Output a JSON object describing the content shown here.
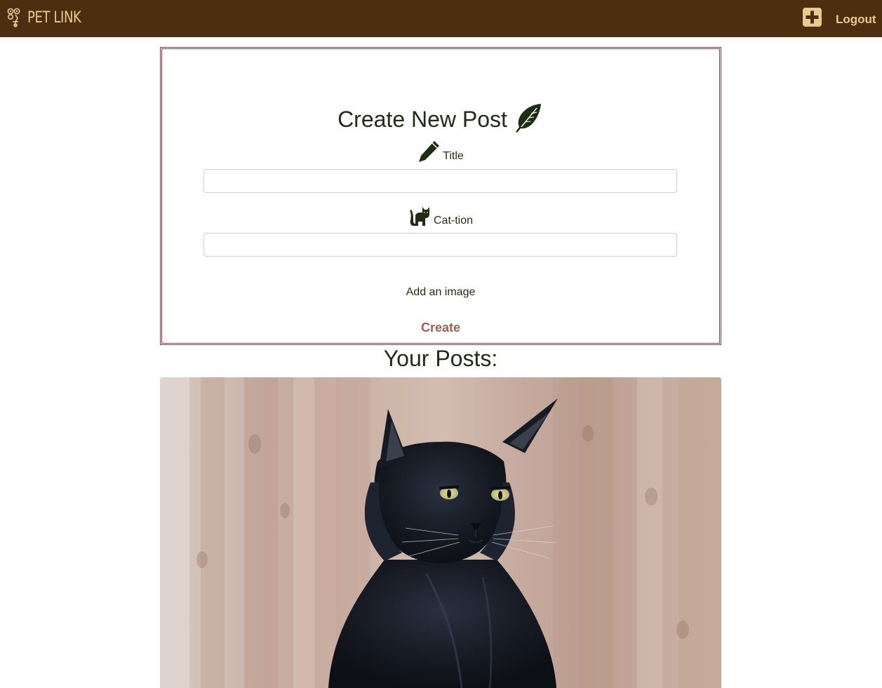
{
  "navbar": {
    "brand_text": "PET LINK",
    "logout_label": "Logout",
    "brand_color": "#e8c992",
    "background_color": "#4d2f10",
    "add_icon": "plus-square-icon"
  },
  "create_post": {
    "heading": "Create New Post",
    "heading_icon": "feather-icon",
    "title_label": "Title",
    "title_icon": "pencil-icon",
    "title_value": "",
    "caption_label": "Cat-tion",
    "caption_icon": "cat-icon",
    "caption_value": "",
    "add_image_label": "Add an image",
    "create_label": "Create",
    "border_color": "#a8323a",
    "create_color": "#a0604b"
  },
  "posts": {
    "heading": "Your Posts:",
    "items": [
      {
        "image": "black fluffy cat in front of wooden fence"
      }
    ]
  }
}
